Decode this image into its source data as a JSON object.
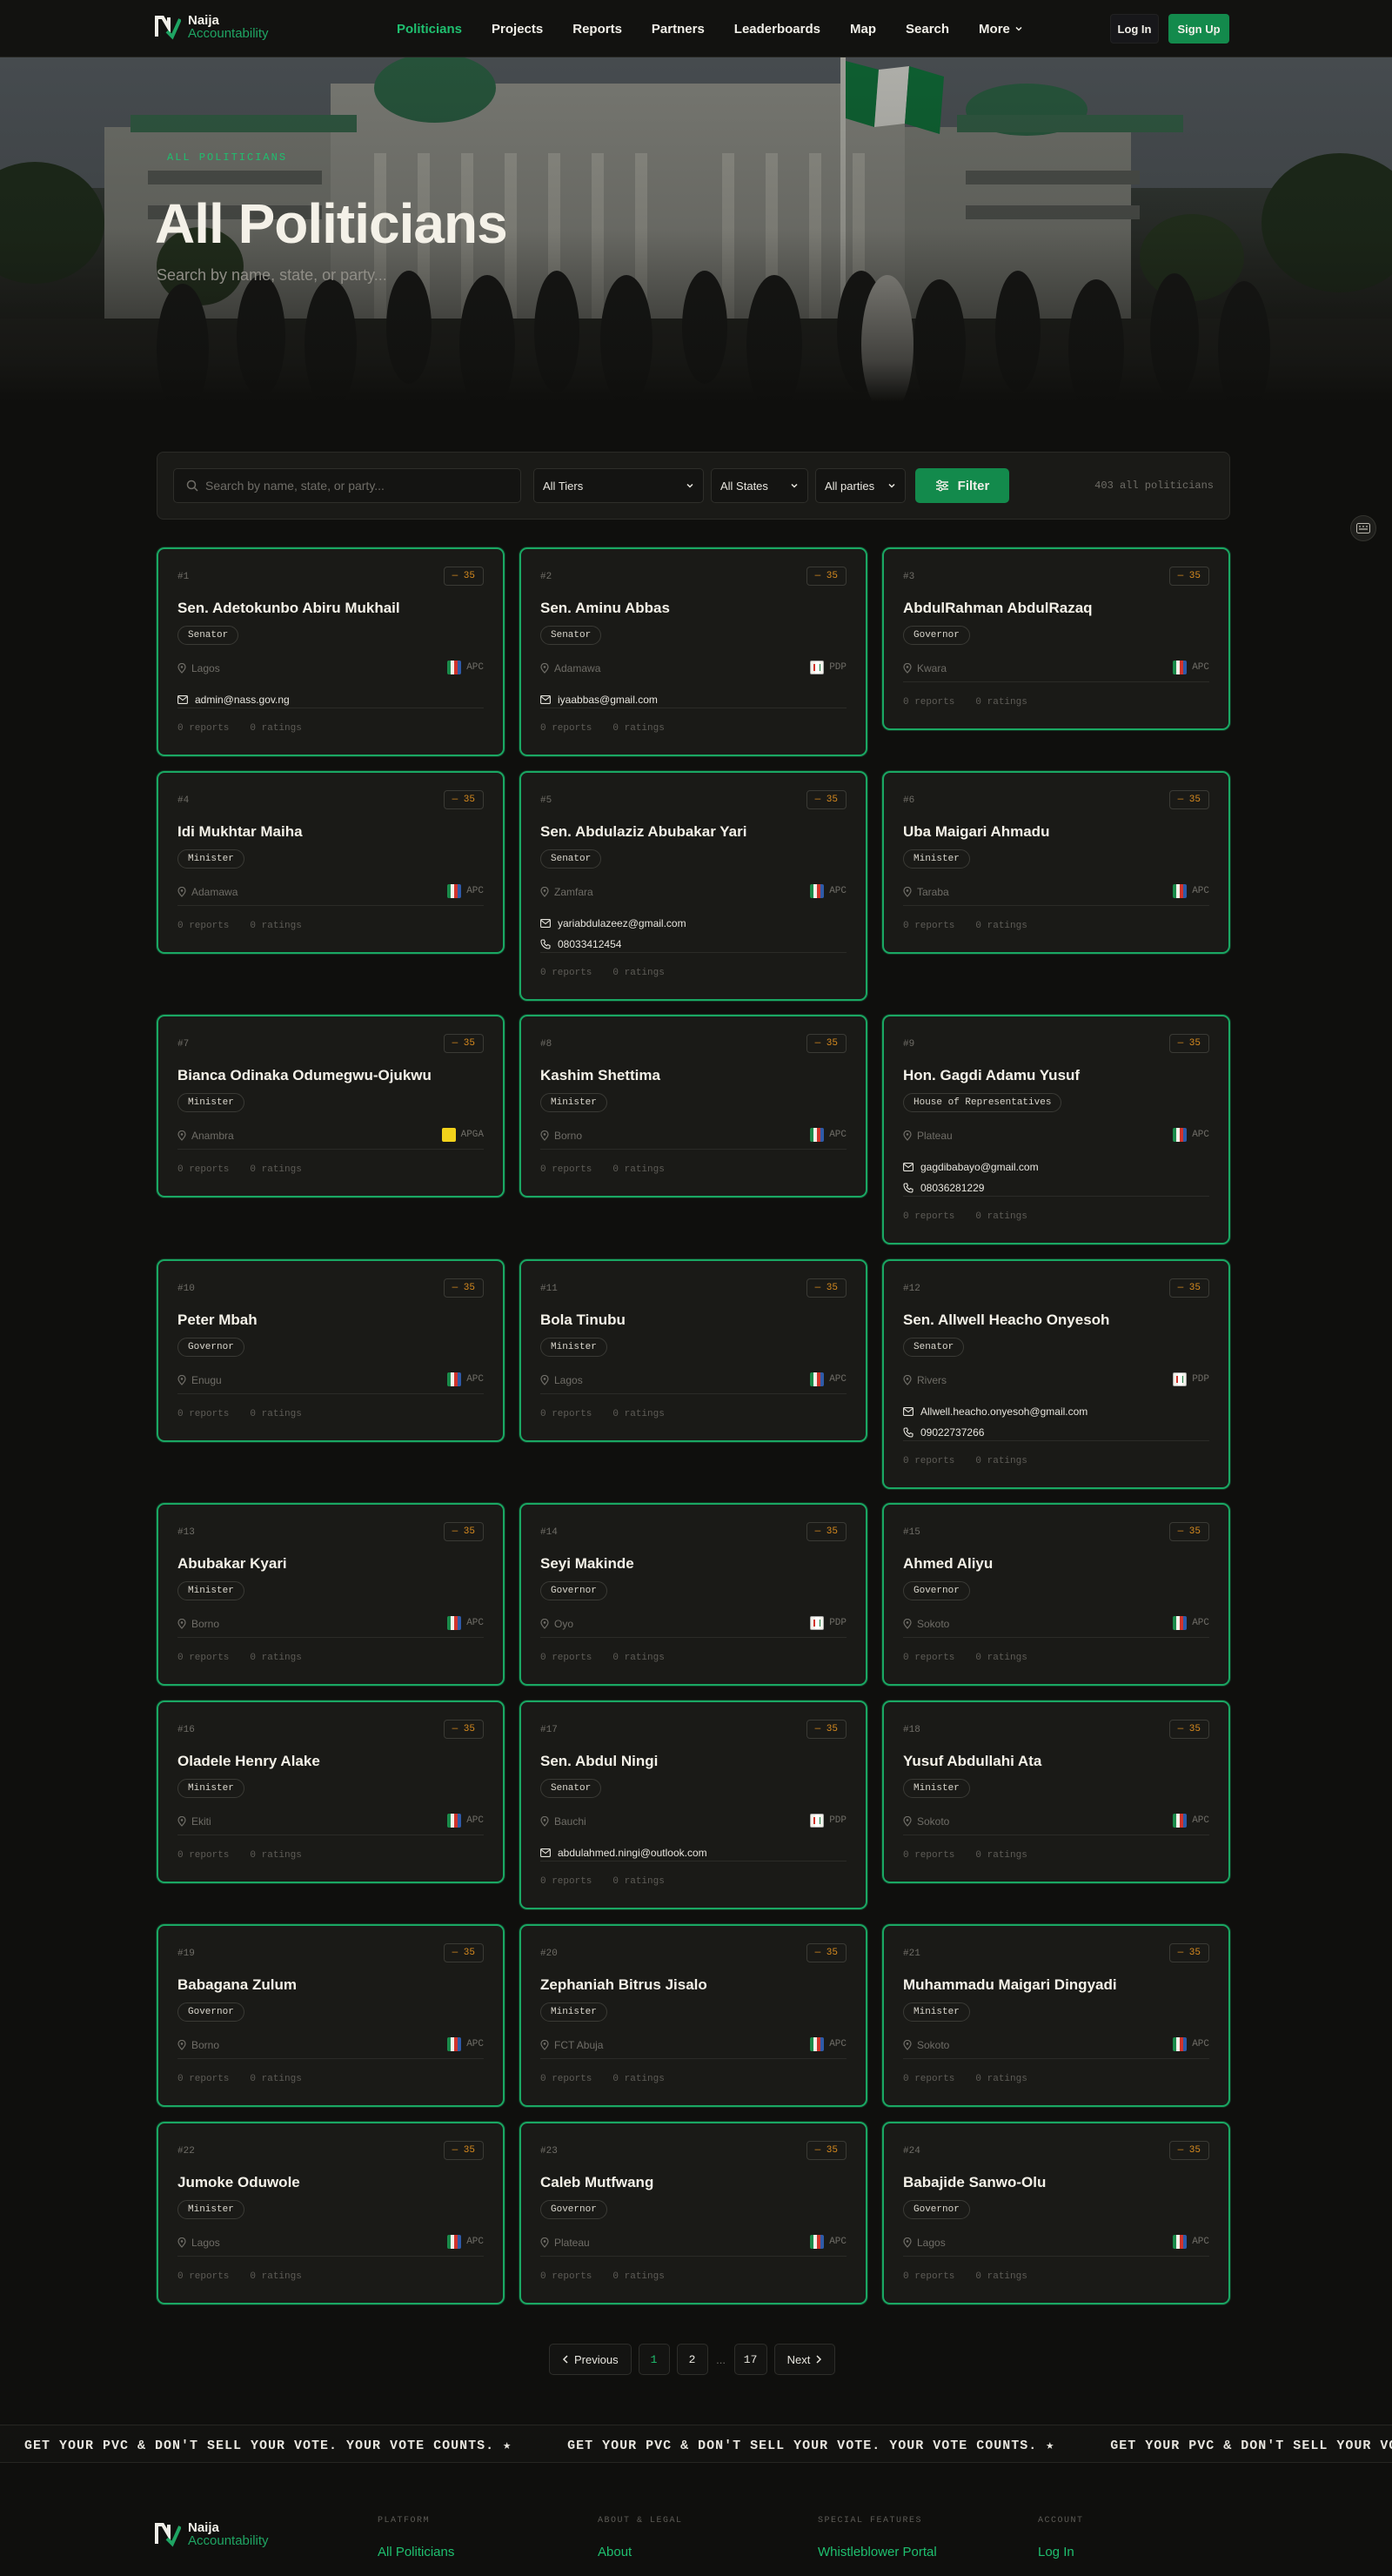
{
  "brand": {
    "line1": "Naija",
    "line2": "Accountability"
  },
  "nav": {
    "links": [
      "Politicians",
      "Projects",
      "Reports",
      "Partners",
      "Leaderboards",
      "Map",
      "Search",
      "More"
    ],
    "login": "Log In",
    "signup": "Sign Up"
  },
  "hero": {
    "eyebrow": "ALL POLITICIANS",
    "title": "All Politicians",
    "subtitle": "Search by name, state, or party..."
  },
  "filters": {
    "search_placeholder": "Search by name, state, or party...",
    "tier": "All Tiers",
    "state": "All States",
    "party": "All parties",
    "filter_button": "Filter",
    "count": "403 all politicians"
  },
  "cards": [
    {
      "num": "#1",
      "score": "— 35",
      "name": "Sen. Adetokunbo Abiru Mukhail",
      "role": "Senator",
      "state": "Lagos",
      "party": "APC",
      "email": "admin@nass.gov.ng",
      "phone": "",
      "stats": [
        "0 reports",
        "0 ratings"
      ]
    },
    {
      "num": "#2",
      "score": "— 35",
      "name": "Sen. Aminu Abbas",
      "role": "Senator",
      "state": "Adamawa",
      "party": "PDP",
      "email": "iyaabbas@gmail.com",
      "phone": "",
      "stats": [
        "0 reports",
        "0 ratings"
      ]
    },
    {
      "num": "#3",
      "score": "— 35",
      "name": "AbdulRahman AbdulRazaq",
      "role": "Governor",
      "state": "Kwara",
      "party": "APC",
      "email": "",
      "phone": "",
      "stats": [
        "0 reports",
        "0 ratings"
      ]
    },
    {
      "num": "#4",
      "score": "— 35",
      "name": "Idi Mukhtar Maiha",
      "role": "Minister",
      "state": "Adamawa",
      "party": "APC",
      "email": "",
      "phone": "",
      "stats": [
        "0 reports",
        "0 ratings"
      ]
    },
    {
      "num": "#5",
      "score": "— 35",
      "name": "Sen. Abdulaziz Abubakar Yari",
      "role": "Senator",
      "state": "Zamfara",
      "party": "APC",
      "email": "yariabdulazeez@gmail.com",
      "phone": "08033412454",
      "stats": [
        "0 reports",
        "0 ratings"
      ]
    },
    {
      "num": "#6",
      "score": "— 35",
      "name": "Uba Maigari Ahmadu",
      "role": "Minister",
      "state": "Taraba",
      "party": "APC",
      "email": "",
      "phone": "",
      "stats": [
        "0 reports",
        "0 ratings"
      ]
    },
    {
      "num": "#7",
      "score": "— 35",
      "name": "Bianca Odinaka Odumegwu-Ojukwu",
      "role": "Minister",
      "state": "Anambra",
      "party": "APGA",
      "email": "",
      "phone": "",
      "stats": [
        "0 reports",
        "0 ratings"
      ]
    },
    {
      "num": "#8",
      "score": "— 35",
      "name": "Kashim Shettima",
      "role": "Minister",
      "state": "Borno",
      "party": "APC",
      "email": "",
      "phone": "",
      "stats": [
        "0 reports",
        "0 ratings"
      ]
    },
    {
      "num": "#9",
      "score": "— 35",
      "name": "Hon. Gagdi Adamu Yusuf",
      "role": "House of Representatives",
      "state": "Plateau",
      "party": "APC",
      "email": "gagdibabayo@gmail.com",
      "phone": "08036281229",
      "stats": [
        "0 reports",
        "0 ratings"
      ]
    },
    {
      "num": "#10",
      "score": "— 35",
      "name": "Peter Mbah",
      "role": "Governor",
      "state": "Enugu",
      "party": "APC",
      "email": "",
      "phone": "",
      "stats": [
        "0 reports",
        "0 ratings"
      ]
    },
    {
      "num": "#11",
      "score": "— 35",
      "name": "Bola Tinubu",
      "role": "Minister",
      "state": "Lagos",
      "party": "APC",
      "email": "",
      "phone": "",
      "stats": [
        "0 reports",
        "0 ratings"
      ]
    },
    {
      "num": "#12",
      "score": "— 35",
      "name": "Sen. Allwell Heacho Onyesoh",
      "role": "Senator",
      "state": "Rivers",
      "party": "PDP",
      "email": "Allwell.heacho.onyesoh@gmail.com",
      "phone": "09022737266",
      "stats": [
        "0 reports",
        "0 ratings"
      ]
    },
    {
      "num": "#13",
      "score": "— 35",
      "name": "Abubakar Kyari",
      "role": "Minister",
      "state": "Borno",
      "party": "APC",
      "email": "",
      "phone": "",
      "stats": [
        "0 reports",
        "0 ratings"
      ]
    },
    {
      "num": "#14",
      "score": "— 35",
      "name": "Seyi Makinde",
      "role": "Governor",
      "state": "Oyo",
      "party": "PDP",
      "email": "",
      "phone": "",
      "stats": [
        "0 reports",
        "0 ratings"
      ]
    },
    {
      "num": "#15",
      "score": "— 35",
      "name": "Ahmed Aliyu",
      "role": "Governor",
      "state": "Sokoto",
      "party": "APC",
      "email": "",
      "phone": "",
      "stats": [
        "0 reports",
        "0 ratings"
      ]
    },
    {
      "num": "#16",
      "score": "— 35",
      "name": "Oladele Henry Alake",
      "role": "Minister",
      "state": "Ekiti",
      "party": "APC",
      "email": "",
      "phone": "",
      "stats": [
        "0 reports",
        "0 ratings"
      ]
    },
    {
      "num": "#17",
      "score": "— 35",
      "name": "Sen. Abdul Ningi",
      "role": "Senator",
      "state": "Bauchi",
      "party": "PDP",
      "email": "abdulahmed.ningi@outlook.com",
      "phone": "",
      "stats": [
        "0 reports",
        "0 ratings"
      ]
    },
    {
      "num": "#18",
      "score": "— 35",
      "name": "Yusuf Abdullahi Ata",
      "role": "Minister",
      "state": "Sokoto",
      "party": "APC",
      "email": "",
      "phone": "",
      "stats": [
        "0 reports",
        "0 ratings"
      ]
    },
    {
      "num": "#19",
      "score": "— 35",
      "name": "Babagana Zulum",
      "role": "Governor",
      "state": "Borno",
      "party": "APC",
      "email": "",
      "phone": "",
      "stats": [
        "0 reports",
        "0 ratings"
      ]
    },
    {
      "num": "#20",
      "score": "— 35",
      "name": "Zephaniah Bitrus Jisalo",
      "role": "Minister",
      "state": "FCT Abuja",
      "party": "APC",
      "email": "",
      "phone": "",
      "stats": [
        "0 reports",
        "0 ratings"
      ]
    },
    {
      "num": "#21",
      "score": "— 35",
      "name": "Muhammadu Maigari Dingyadi",
      "role": "Minister",
      "state": "Sokoto",
      "party": "APC",
      "email": "",
      "phone": "",
      "stats": [
        "0 reports",
        "0 ratings"
      ]
    },
    {
      "num": "#22",
      "score": "— 35",
      "name": "Jumoke Oduwole",
      "role": "Minister",
      "state": "Lagos",
      "party": "APC",
      "email": "",
      "phone": "",
      "stats": [
        "0 reports",
        "0 ratings"
      ]
    },
    {
      "num": "#23",
      "score": "— 35",
      "name": "Caleb Mutfwang",
      "role": "Governor",
      "state": "Plateau",
      "party": "APC",
      "email": "",
      "phone": "",
      "stats": [
        "0 reports",
        "0 ratings"
      ]
    },
    {
      "num": "#24",
      "score": "— 35",
      "name": "Babajide Sanwo-Olu",
      "role": "Governor",
      "state": "Lagos",
      "party": "APC",
      "email": "",
      "phone": "",
      "stats": [
        "0 reports",
        "0 ratings"
      ]
    }
  ],
  "pagination": {
    "previous": "Previous",
    "pages": [
      "1",
      "2"
    ],
    "ellipsis": "...",
    "last": "17",
    "next": "Next"
  },
  "marquee": {
    "text": "GET YOUR PVC & DON'T SELL YOUR VOTE. YOUR VOTE COUNTS. ★"
  },
  "footer": {
    "columns": [
      {
        "heading": "PLATFORM",
        "link": "All Politicians"
      },
      {
        "heading": "ABOUT & LEGAL",
        "link": "About"
      },
      {
        "heading": "SPECIAL FEATURES",
        "link": "Whistleblower Portal"
      },
      {
        "heading": "ACCOUNT",
        "link": "Log In"
      }
    ]
  },
  "colors": {
    "accent": "#1fbf6f",
    "card_border": "#1aa763",
    "score": "#d68a1f",
    "background": "#0f0f0d"
  }
}
